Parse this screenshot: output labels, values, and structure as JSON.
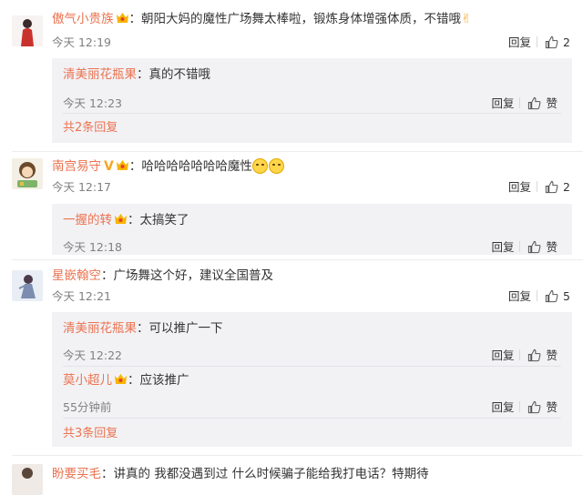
{
  "comments": [
    {
      "username": "傲气小贵族",
      "text": "：朝阳大妈的魔性广场舞太棒啦，锻炼身体增强体质，不错哦",
      "time": "今天 12:19",
      "reply_label": "回复",
      "likes": "2",
      "replies": [
        {
          "username": "清美丽花瓶果",
          "text": "：真的不错哦",
          "time": "今天 12:23",
          "reply_label": "回复",
          "like_label": "赞"
        }
      ],
      "more": "共2条回复"
    },
    {
      "username": "南宫易守",
      "text": "：哈哈哈哈哈哈哈魔性",
      "time": "今天 12:17",
      "reply_label": "回复",
      "likes": "2",
      "replies": [
        {
          "username": "一握的转",
          "text": "：太搞笑了",
          "time": "今天 12:18",
          "reply_label": "回复",
          "like_label": "赞"
        }
      ]
    },
    {
      "username": "星嵌翰空",
      "text": "：广场舞这个好，建议全国普及",
      "time": "今天 12:21",
      "reply_label": "回复",
      "likes": "5",
      "replies": [
        {
          "username": "清美丽花瓶果",
          "text": "：可以推广一下",
          "time": "今天 12:22",
          "reply_label": "回复",
          "like_label": "赞"
        },
        {
          "username": "莫小超儿",
          "text": "：应该推广",
          "time": "55分钟前",
          "reply_label": "回复",
          "like_label": "赞"
        }
      ],
      "more": "共3条回复"
    }
  ],
  "partial_comment": {
    "username": "盼要买毛",
    "text": "：讲真的 我都没遇到过 什么时候骗子能给我打电话？特期待"
  },
  "colors": {
    "username": "#eb7350",
    "time": "#808080",
    "reply_bg": "#f2f2f5"
  }
}
